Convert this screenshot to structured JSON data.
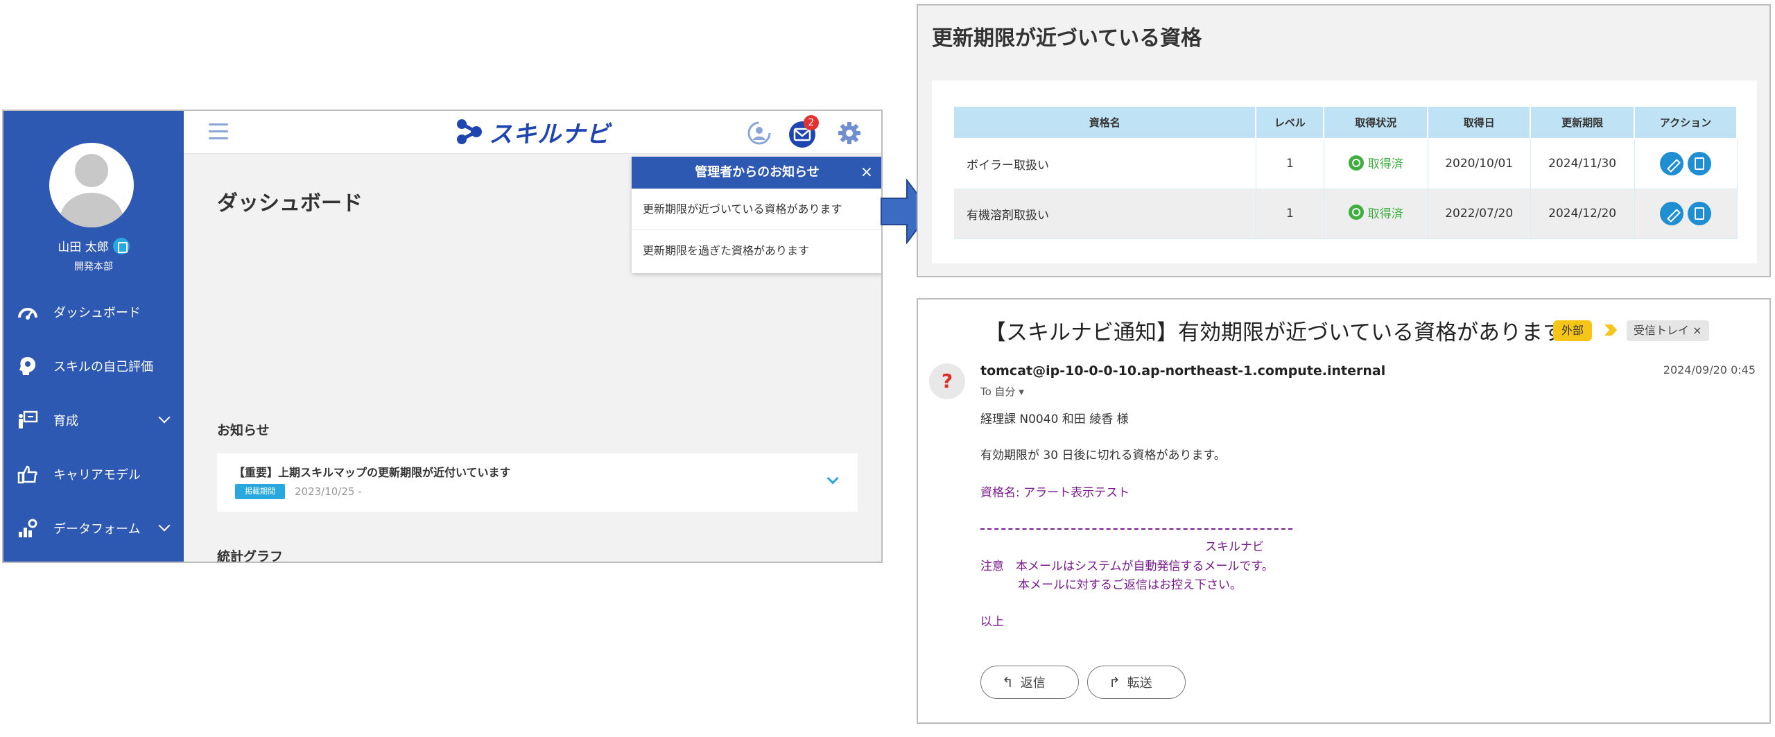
{
  "app": {
    "user": {
      "name": "山田 太郎",
      "dept": "開発本部"
    },
    "nav": [
      {
        "label": "ダッシュボード"
      },
      {
        "label": "スキルの自己評価"
      },
      {
        "label": "育成"
      },
      {
        "label": "キャリアモデル"
      },
      {
        "label": "データフォーム"
      }
    ],
    "logo": "スキルナビ",
    "mail_count": "2",
    "page_title": "ダッシュボード",
    "notif_popup": {
      "title": "管理者からのお知らせ",
      "close": "×",
      "items": [
        "更新期限が近づいている資格があります",
        "更新期限を過ぎた資格があります"
      ]
    },
    "news": {
      "heading": "お知らせ",
      "title": "【重要】上期スキルマップの更新期限が近付いています",
      "tag": "掲載期間",
      "date": "2023/10/25 -"
    },
    "stats_heading": "統計グラフ"
  },
  "qual_panel": {
    "title": "更新期限が近づいている資格",
    "headers": [
      "資格名",
      "レベル",
      "取得状況",
      "取得日",
      "更新期限",
      "アクション"
    ],
    "rows": [
      {
        "name": "ボイラー取扱い",
        "level": "1",
        "status": "取得済",
        "acquired": "2020/10/01",
        "deadline": "2024/11/30"
      },
      {
        "name": "有機溶剤取扱い",
        "level": "1",
        "status": "取得済",
        "acquired": "2022/07/20",
        "deadline": "2024/12/20"
      }
    ]
  },
  "email": {
    "subject": "【スキルナビ通知】有効期限が近づいている資格があります",
    "label_external": "外部",
    "label_inbox": "受信トレイ ×",
    "avatar": "?",
    "from": "tomcat@ip-10-0-0-10.ap-northeast-1.compute.internal",
    "to": "To 自分 ▾",
    "date": "2024/09/20 0:45",
    "greeting": "経理課 N0040 和田 綾香 様",
    "body1": "有効期限が 30 日後に切れる資格があります。",
    "qual_line": "資格名: アラート表示テスト",
    "signature": "スキルナビ",
    "note1": "注意　本メールはシステムが自動発信するメールです。",
    "note2": "本メールに対するご返信はお控え下さい。",
    "closing": "以上",
    "reply": "返信",
    "forward": "転送"
  },
  "colors": {
    "brand_blue": "#2e59b3",
    "accent_cyan": "#29a8e0",
    "status_green": "#3fae3f",
    "email_purple": "#7a1a8f",
    "label_yellow": "#f5c518"
  }
}
